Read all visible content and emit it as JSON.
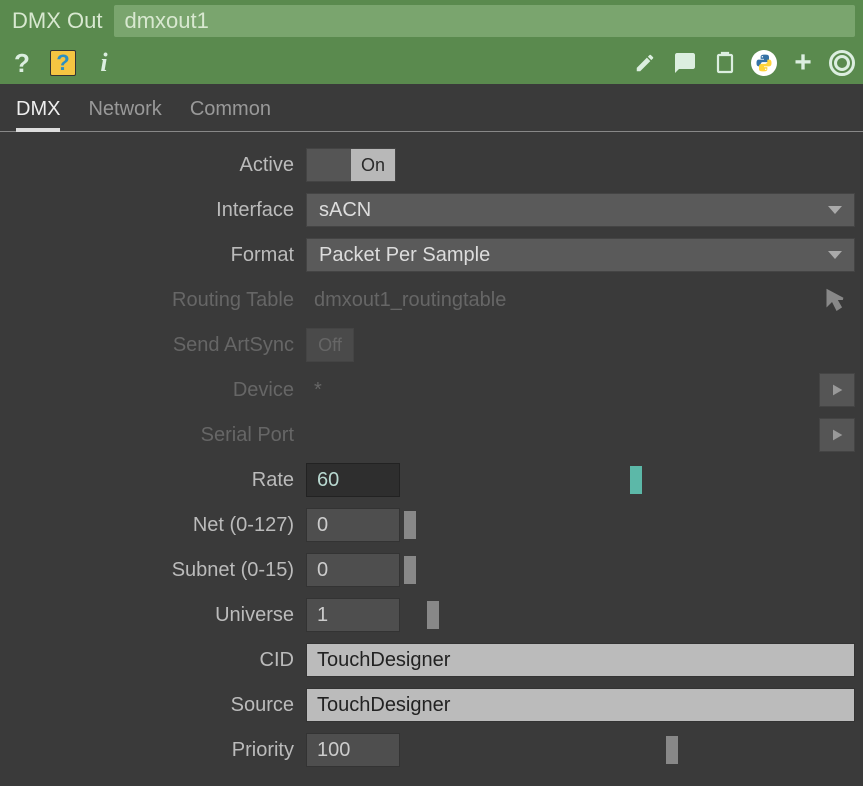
{
  "header": {
    "type_label": "DMX Out",
    "name": "dmxout1"
  },
  "tabs": [
    "DMX",
    "Network",
    "Common"
  ],
  "active_tab": 0,
  "params": {
    "active": {
      "label": "Active",
      "value": "On"
    },
    "interface": {
      "label": "Interface",
      "value": "sACN"
    },
    "format": {
      "label": "Format",
      "value": "Packet Per Sample"
    },
    "routing_table": {
      "label": "Routing Table",
      "value": "dmxout1_routingtable"
    },
    "send_artsync": {
      "label": "Send ArtSync",
      "value": "Off"
    },
    "device": {
      "label": "Device",
      "value": "*"
    },
    "serial_port": {
      "label": "Serial Port",
      "value": ""
    },
    "rate": {
      "label": "Rate",
      "value": "60",
      "slider_pct": 50
    },
    "net": {
      "label": "Net (0-127)",
      "value": "0",
      "slider_pct": 0
    },
    "subnet": {
      "label": "Subnet (0-15)",
      "value": "0",
      "slider_pct": 0
    },
    "universe": {
      "label": "Universe",
      "value": "1",
      "slider_pct": 5
    },
    "cid": {
      "label": "CID",
      "value": "TouchDesigner"
    },
    "source": {
      "label": "Source",
      "value": "TouchDesigner"
    },
    "priority": {
      "label": "Priority",
      "value": "100",
      "slider_pct": 58
    }
  }
}
